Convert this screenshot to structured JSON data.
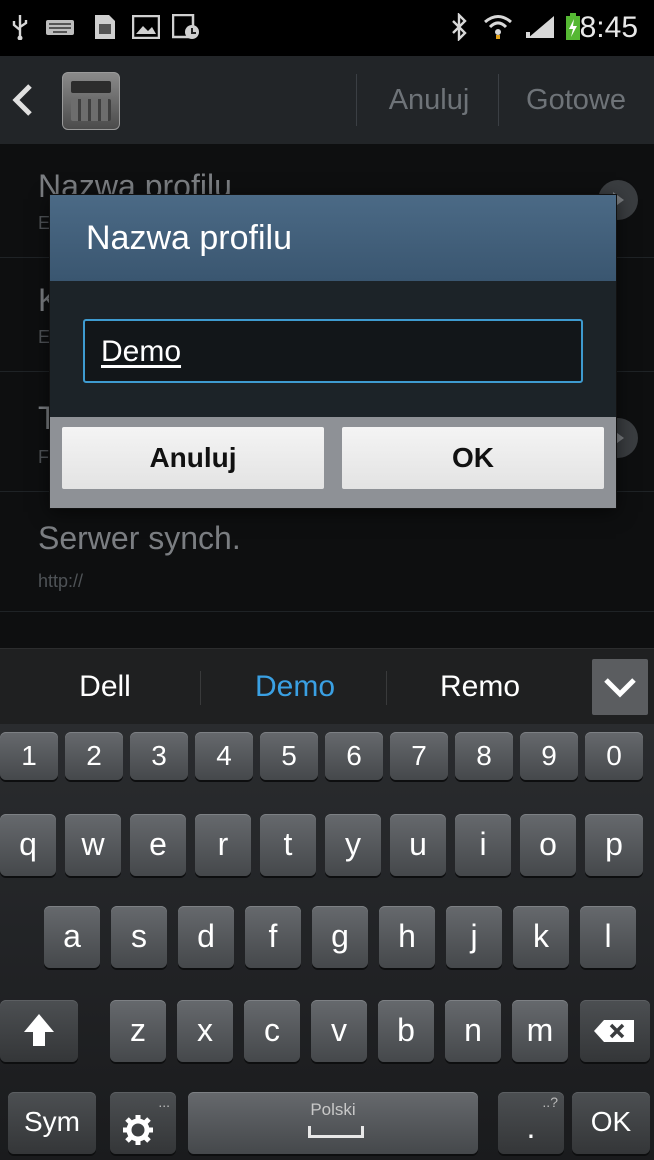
{
  "status_bar": {
    "icons": [
      "usb-icon",
      "keyboard-icon",
      "sim-card-icon",
      "gallery-icon",
      "screenshot-icon",
      "bluetooth-icon",
      "wifi-icon",
      "signal-icon",
      "battery-charging-icon"
    ],
    "time": "8:45"
  },
  "action_bar": {
    "back_icon": "back-arrow-icon",
    "app_icon": "calculator-app-icon",
    "actions": {
      "cancel": "Anuluj",
      "done": "Gotowe"
    }
  },
  "settings_list": {
    "items": [
      {
        "title": "Nazwa profilu",
        "subtitle": "E"
      },
      {
        "title": "K",
        "subtitle": "E"
      },
      {
        "title": "T",
        "subtitle": "F"
      },
      {
        "title": "Serwer synch.",
        "subtitle": "http://"
      }
    ]
  },
  "dialog": {
    "title": "Nazwa profilu",
    "input_value": "Demo",
    "buttons": {
      "cancel": "Anuluj",
      "ok": "OK"
    }
  },
  "keyboard": {
    "suggestions": [
      "Dell",
      "Demo",
      "Remo"
    ],
    "highlighted_suggestion": "Demo",
    "collapse_icon": "chevron-down-icon",
    "number_row": [
      "1",
      "2",
      "3",
      "4",
      "5",
      "6",
      "7",
      "8",
      "9",
      "0"
    ],
    "row1": [
      "q",
      "w",
      "e",
      "r",
      "t",
      "y",
      "u",
      "i",
      "o",
      "p"
    ],
    "row2": [
      "a",
      "s",
      "d",
      "f",
      "g",
      "h",
      "j",
      "k",
      "l"
    ],
    "row3": [
      "z",
      "x",
      "c",
      "v",
      "b",
      "n",
      "m"
    ],
    "shift_icon": "shift-arrow-icon",
    "backspace_icon": "backspace-icon",
    "sym_label": "Sym",
    "settings_icon": "gear-icon",
    "space_label": "Polski",
    "period_label": ".",
    "period_hint": "..?",
    "settings_hint": "...",
    "ok_label": "OK"
  },
  "colors": {
    "accent_blue": "#3e9bd0",
    "dialog_header": "#4b6a86",
    "suggestion_highlight": "#3aa0e3"
  }
}
